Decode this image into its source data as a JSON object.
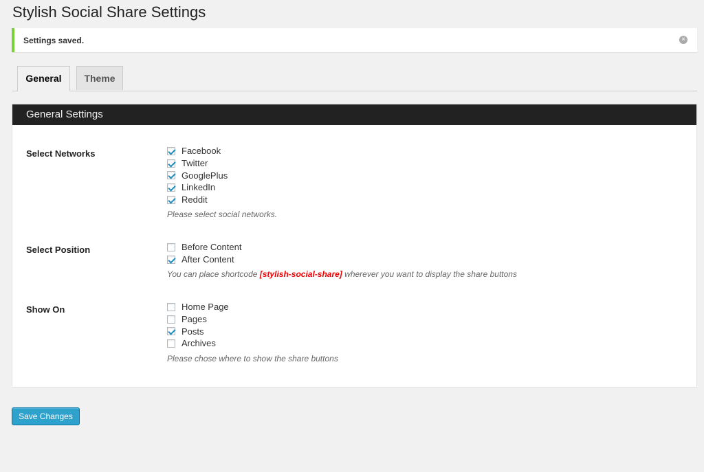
{
  "page": {
    "title": "Stylish Social Share Settings"
  },
  "notice": {
    "text": "Settings saved.",
    "dismiss_icon": "close-circle-icon"
  },
  "tabs": [
    {
      "label": "General",
      "active": true
    },
    {
      "label": "Theme",
      "active": false
    }
  ],
  "panel": {
    "title": "General Settings"
  },
  "networks": {
    "label": "Select Networks",
    "options": [
      {
        "label": "Facebook",
        "checked": true
      },
      {
        "label": "Twitter",
        "checked": true
      },
      {
        "label": "GooglePlus",
        "checked": true
      },
      {
        "label": "LinkedIn",
        "checked": true
      },
      {
        "label": "Reddit",
        "checked": true
      }
    ],
    "description": "Please select social networks."
  },
  "position": {
    "label": "Select Position",
    "options": [
      {
        "label": "Before Content",
        "checked": false
      },
      {
        "label": "After Content",
        "checked": true
      }
    ],
    "description_prefix": "You can place shortcode ",
    "shortcode": "[stylish-social-share]",
    "description_suffix": " wherever you want to display the share buttons"
  },
  "show_on": {
    "label": "Show On",
    "options": [
      {
        "label": "Home Page",
        "checked": false
      },
      {
        "label": "Pages",
        "checked": false
      },
      {
        "label": "Posts",
        "checked": true
      },
      {
        "label": "Archives",
        "checked": false
      }
    ],
    "description": "Please chose where to show the share buttons"
  },
  "actions": {
    "save_label": "Save Changes"
  },
  "colors": {
    "notice_border": "#7ad03a",
    "panel_header_bg": "#222222",
    "button_bg": "#2ea2cc",
    "check_color": "#1e8cbe",
    "shortcode_color": "#ee0000"
  }
}
